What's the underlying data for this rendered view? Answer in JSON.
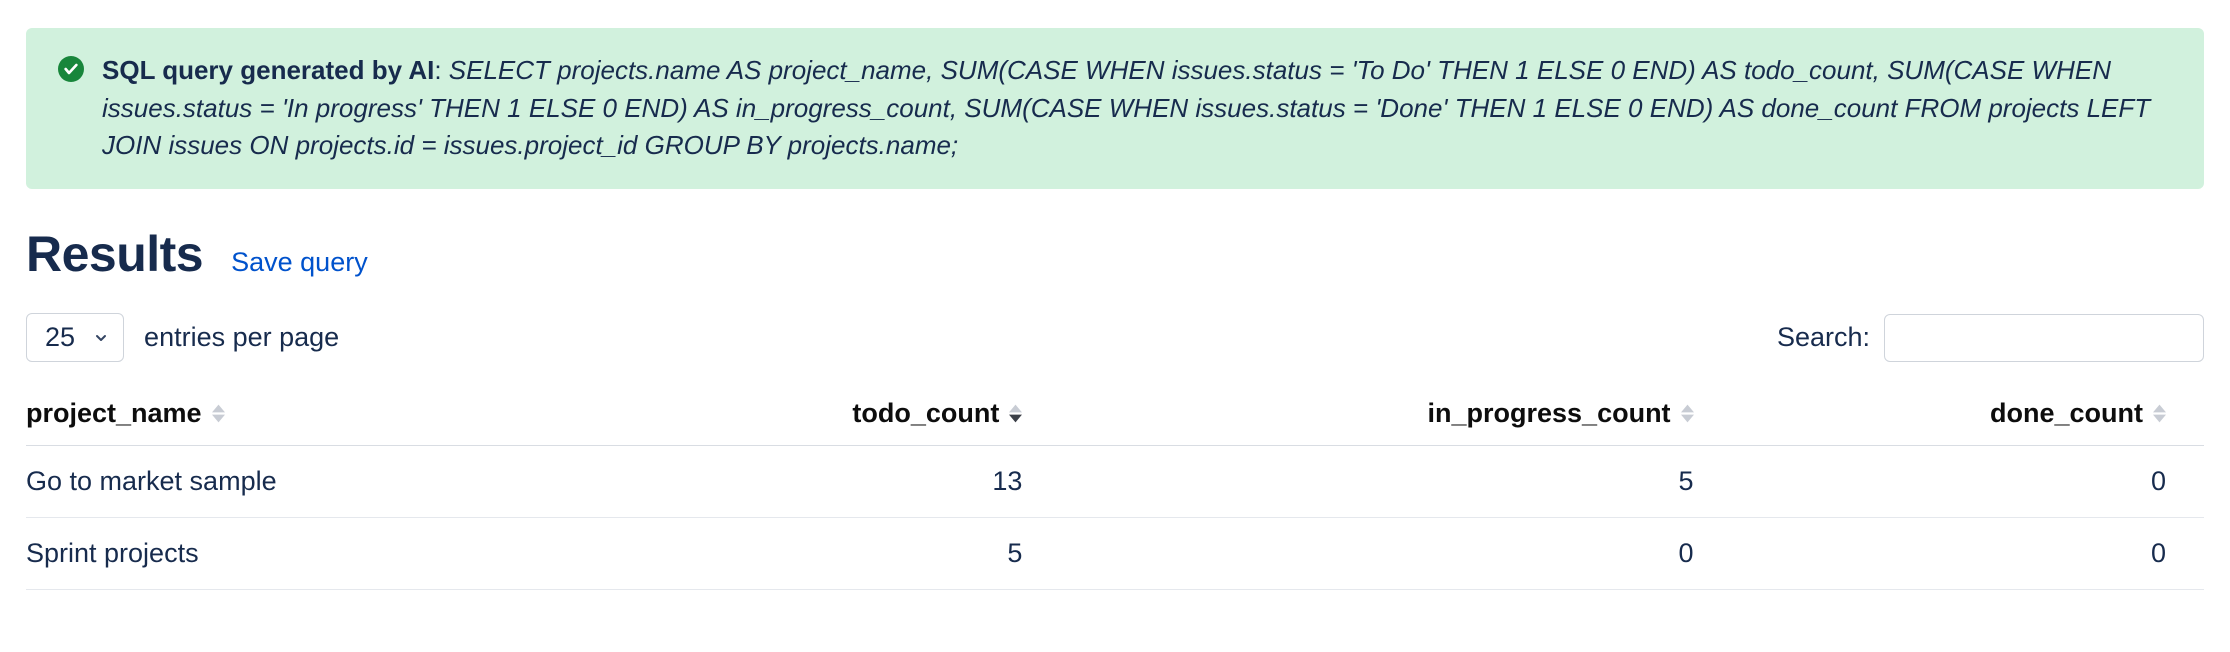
{
  "alert": {
    "prefix": "SQL query generated by AI",
    "separator": ": ",
    "query": "SELECT projects.name AS project_name, SUM(CASE WHEN issues.status = 'To Do' THEN 1 ELSE 0 END) AS todo_count, SUM(CASE WHEN issues.status = 'In progress' THEN 1 ELSE 0 END) AS in_progress_count, SUM(CASE WHEN issues.status = 'Done' THEN 1 ELSE 0 END) AS done_count FROM projects LEFT JOIN issues ON projects.id = issues.project_id GROUP BY projects.name;"
  },
  "results": {
    "title": "Results",
    "save_label": "Save query"
  },
  "controls": {
    "page_size": "25",
    "entries_label": "entries per page",
    "search_label": "Search:",
    "search_value": ""
  },
  "table": {
    "columns": [
      {
        "key": "project_name",
        "label": "project_name",
        "align": "left",
        "sorted": "none"
      },
      {
        "key": "todo_count",
        "label": "todo_count",
        "align": "right",
        "sorted": "desc"
      },
      {
        "key": "in_progress_count",
        "label": "in_progress_count",
        "align": "right",
        "sorted": "none"
      },
      {
        "key": "done_count",
        "label": "done_count",
        "align": "right",
        "sorted": "none"
      }
    ],
    "rows": [
      {
        "project_name": "Go to market sample",
        "todo_count": "13",
        "in_progress_count": "5",
        "done_count": "0"
      },
      {
        "project_name": "Sprint projects",
        "todo_count": "5",
        "in_progress_count": "0",
        "done_count": "0"
      }
    ]
  }
}
